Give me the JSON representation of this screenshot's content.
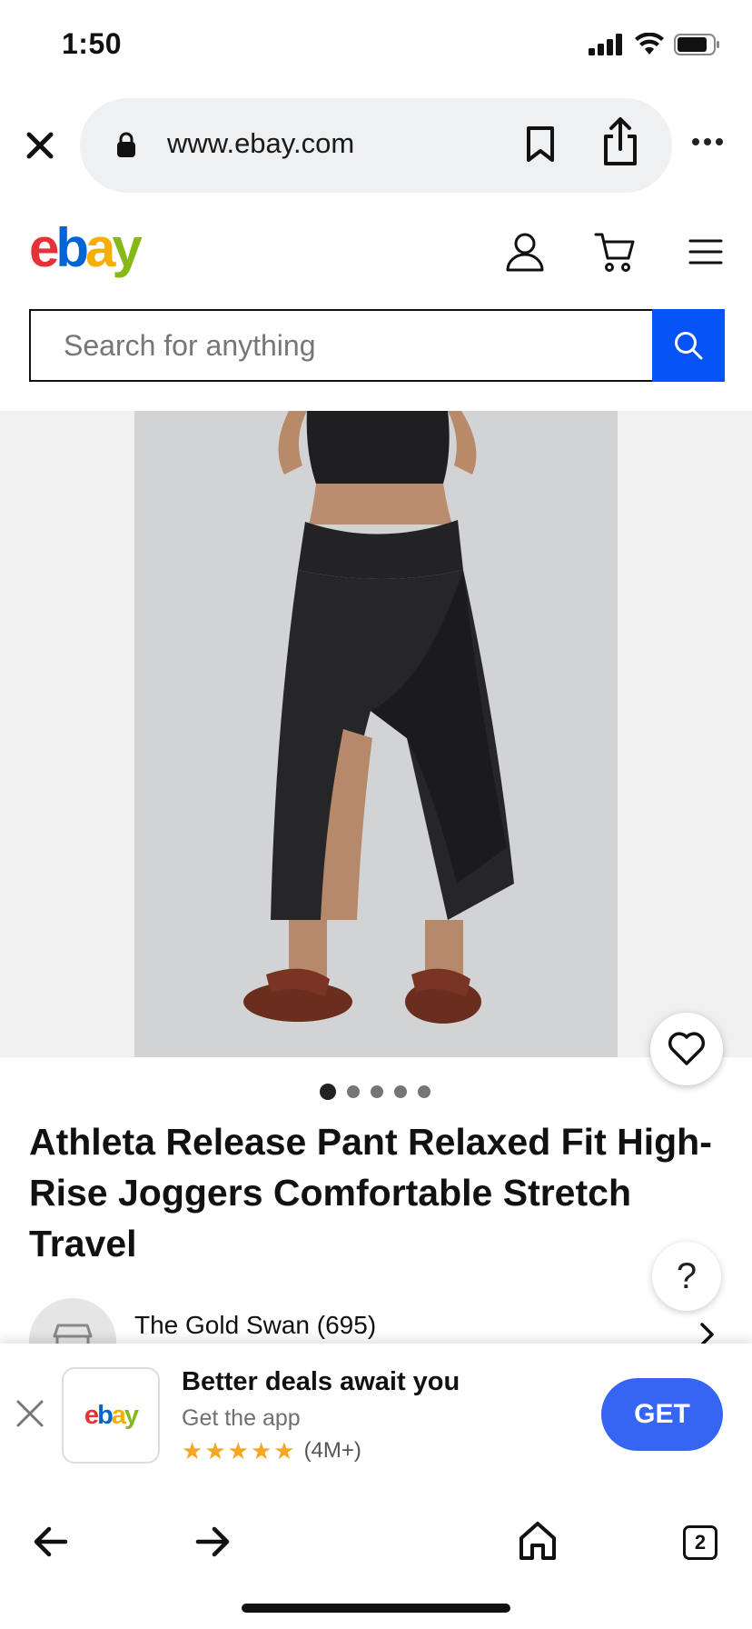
{
  "status_bar": {
    "time": "1:50"
  },
  "browser": {
    "url": "www.ebay.com"
  },
  "header": {
    "logo": {
      "e": "e",
      "b": "b",
      "a": "a",
      "y": "y"
    },
    "colors": {
      "e": "#e53238",
      "b": "#0064d2",
      "a": "#f5af02",
      "y": "#86b817"
    }
  },
  "search": {
    "placeholder": "Search for anything",
    "button_color": "#0654f5"
  },
  "gallery": {
    "image_count": 5,
    "active_index": 0
  },
  "product": {
    "title": "Athleta Release Pant Relaxed Fit High-Rise Joggers Comfortable Stretch Travel"
  },
  "seller": {
    "name": "The Gold Swan (695)"
  },
  "help": {
    "label": "?"
  },
  "app_banner": {
    "title": "Better deals await you",
    "subtitle": "Get the app",
    "rating_count": "(4M+)",
    "stars": 5,
    "get_label": "GET",
    "logo_text": "ebay"
  },
  "toolbar": {
    "tab_count": "2"
  }
}
